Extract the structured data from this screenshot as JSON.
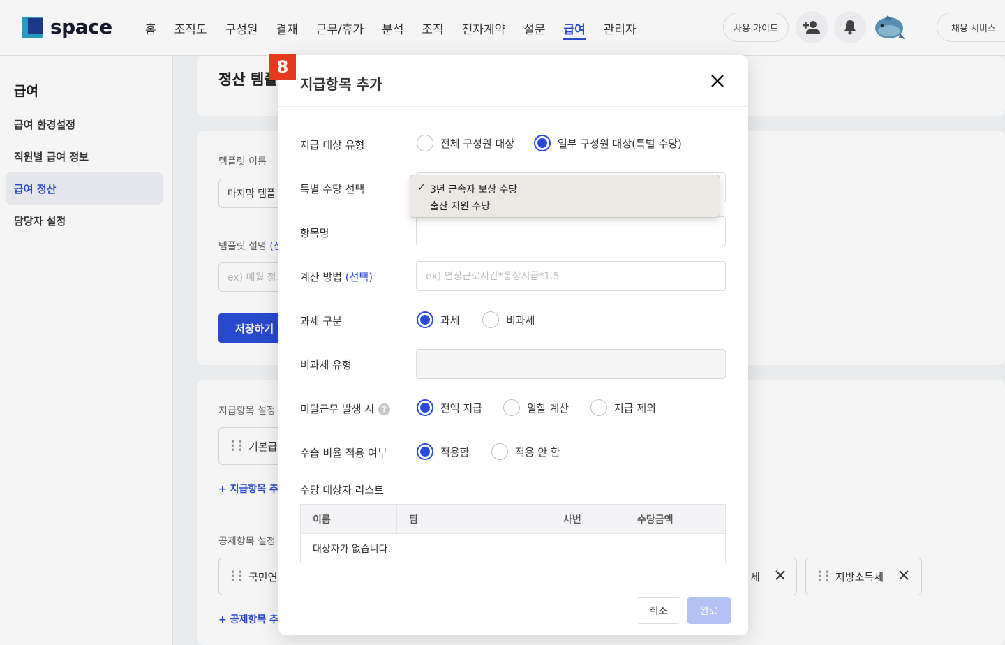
{
  "header": {
    "logo_text": "space",
    "nav": [
      "홈",
      "조직도",
      "구성원",
      "결재",
      "근무/휴가",
      "분석",
      "조직",
      "전자계약",
      "설문",
      "급여",
      "관리자"
    ],
    "active_nav": "급여",
    "guide_label": "사용 가이드",
    "hire_label": "채용 서비스"
  },
  "sidebar": {
    "title": "급여",
    "items": [
      "급여 환경설정",
      "직원별 급여 정보",
      "급여 정산",
      "담당자 설정"
    ],
    "active": "급여 정산"
  },
  "background": {
    "page_title": "정산 템플",
    "template_name_label": "템플릿 이름",
    "template_name_value": "마지막 템플",
    "template_desc_label": "템플릿 설명",
    "template_desc_suffix": "(선",
    "template_desc_placeholder": "ex) 매월 정기",
    "save_label": "저장하기",
    "pay_items_label": "지급항목 설정",
    "pay_item_chip": "기본급",
    "add_pay_item": "+ 지급항목 추가",
    "deduction_label": "공제항목 설정",
    "deduction_chip_1": "국민연",
    "deduction_chip_2": "세",
    "deduction_chip_3": "지방소득세",
    "add_deduction": "+ 공제항목 추가"
  },
  "modal": {
    "step": "8",
    "title": "지급항목 추가",
    "target_type_label": "지급 대상 유형",
    "target_all": "전체 구성원 대상",
    "target_partial": "일부 구성원 대상(특별 수당)",
    "special_label": "특별 수당 선택",
    "special_options": [
      "3년 근속자 보상 수당",
      "출산 지원 수당"
    ],
    "special_checkmark": "✓",
    "item_name_label": "항목명",
    "calc_label": "계산 방법",
    "calc_optional": "(선택)",
    "calc_placeholder": "ex) 연장근로시간*통상시급*1.5",
    "tax_label": "과세 구분",
    "tax_yes": "과세",
    "tax_no": "비과세",
    "nontax_type_label": "비과세 유형",
    "partial_label": "미달근무 발생 시",
    "partial_full": "전액 지급",
    "partial_prorate": "일할 계산",
    "partial_exclude": "지급 제외",
    "probation_label": "수습 비율 적용 여부",
    "probation_apply": "적용함",
    "probation_not": "적용 안 함",
    "list_title": "수당 대상자 리스트",
    "columns": [
      "이름",
      "팀",
      "사번",
      "수당금액"
    ],
    "empty_text": "대상자가 없습니다.",
    "cancel_label": "취소",
    "done_label": "완료"
  },
  "colors": {
    "accent": "#2a4bd8",
    "badge": "#e63a1f",
    "done_disabled": "#b4c2f3"
  }
}
